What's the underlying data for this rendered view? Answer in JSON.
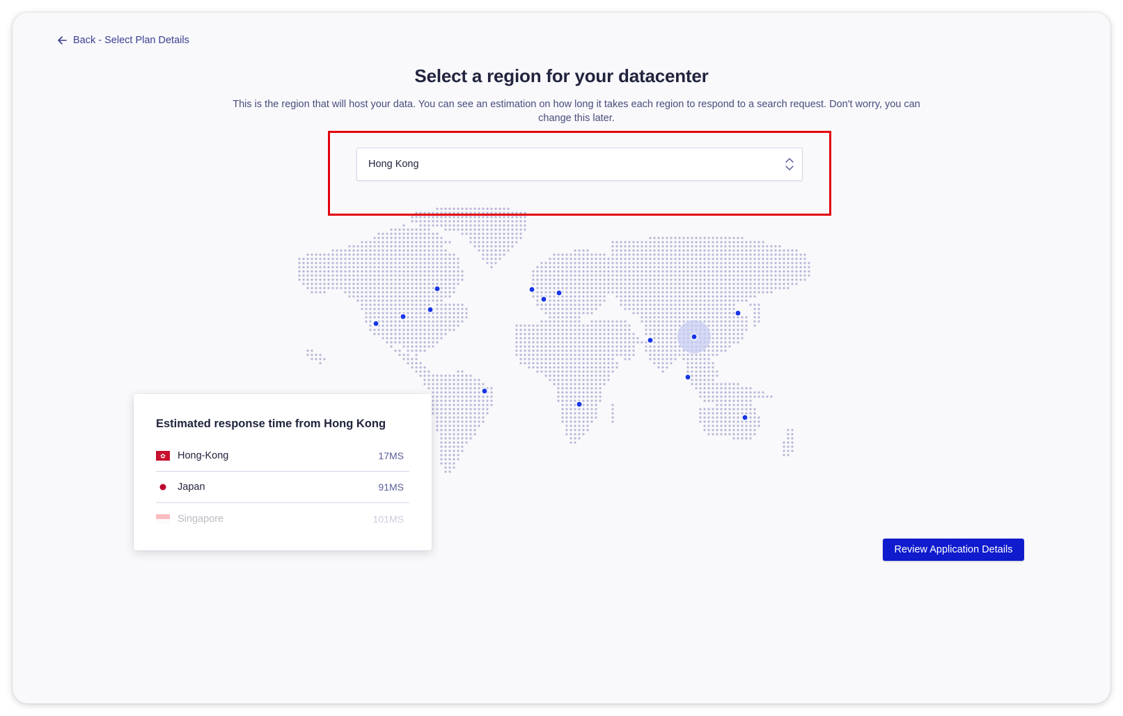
{
  "nav": {
    "back_label": "Back - Select Plan Details"
  },
  "header": {
    "title": "Select a region for your datacenter",
    "subtitle": "This is the region that will host your data. You can see an estimation on how long it takes each region to respond to a search request. Don't worry, you can change this later."
  },
  "region_select": {
    "value": "Hong Kong"
  },
  "map": {
    "dot_color": "#b6b7d5",
    "pin_color": "#1936e6",
    "selected_halo_color": "#c7ccf2",
    "pins": [
      "us-west",
      "us-central",
      "us-east",
      "canada-east",
      "brazil",
      "uk",
      "france",
      "germany",
      "south-africa",
      "india",
      "hong-kong",
      "japan",
      "singapore",
      "australia"
    ],
    "selected_pin": "hong-kong"
  },
  "response_card": {
    "title": "Estimated response time from Hong Kong",
    "rows": [
      {
        "name": "Hong-Kong",
        "value": "17MS",
        "flag": "hong-kong-flag-icon"
      },
      {
        "name": "Japan",
        "value": "91MS",
        "flag": "japan-flag-icon"
      },
      {
        "name": "Singapore",
        "value": "101MS",
        "flag": "singapore-flag-icon"
      }
    ]
  },
  "actions": {
    "primary_label": "Review Application Details"
  },
  "colors": {
    "accent": "#0f1bcd",
    "highlight": "#e3000b",
    "text_dark": "#21243d",
    "text_muted": "#484c7a"
  }
}
